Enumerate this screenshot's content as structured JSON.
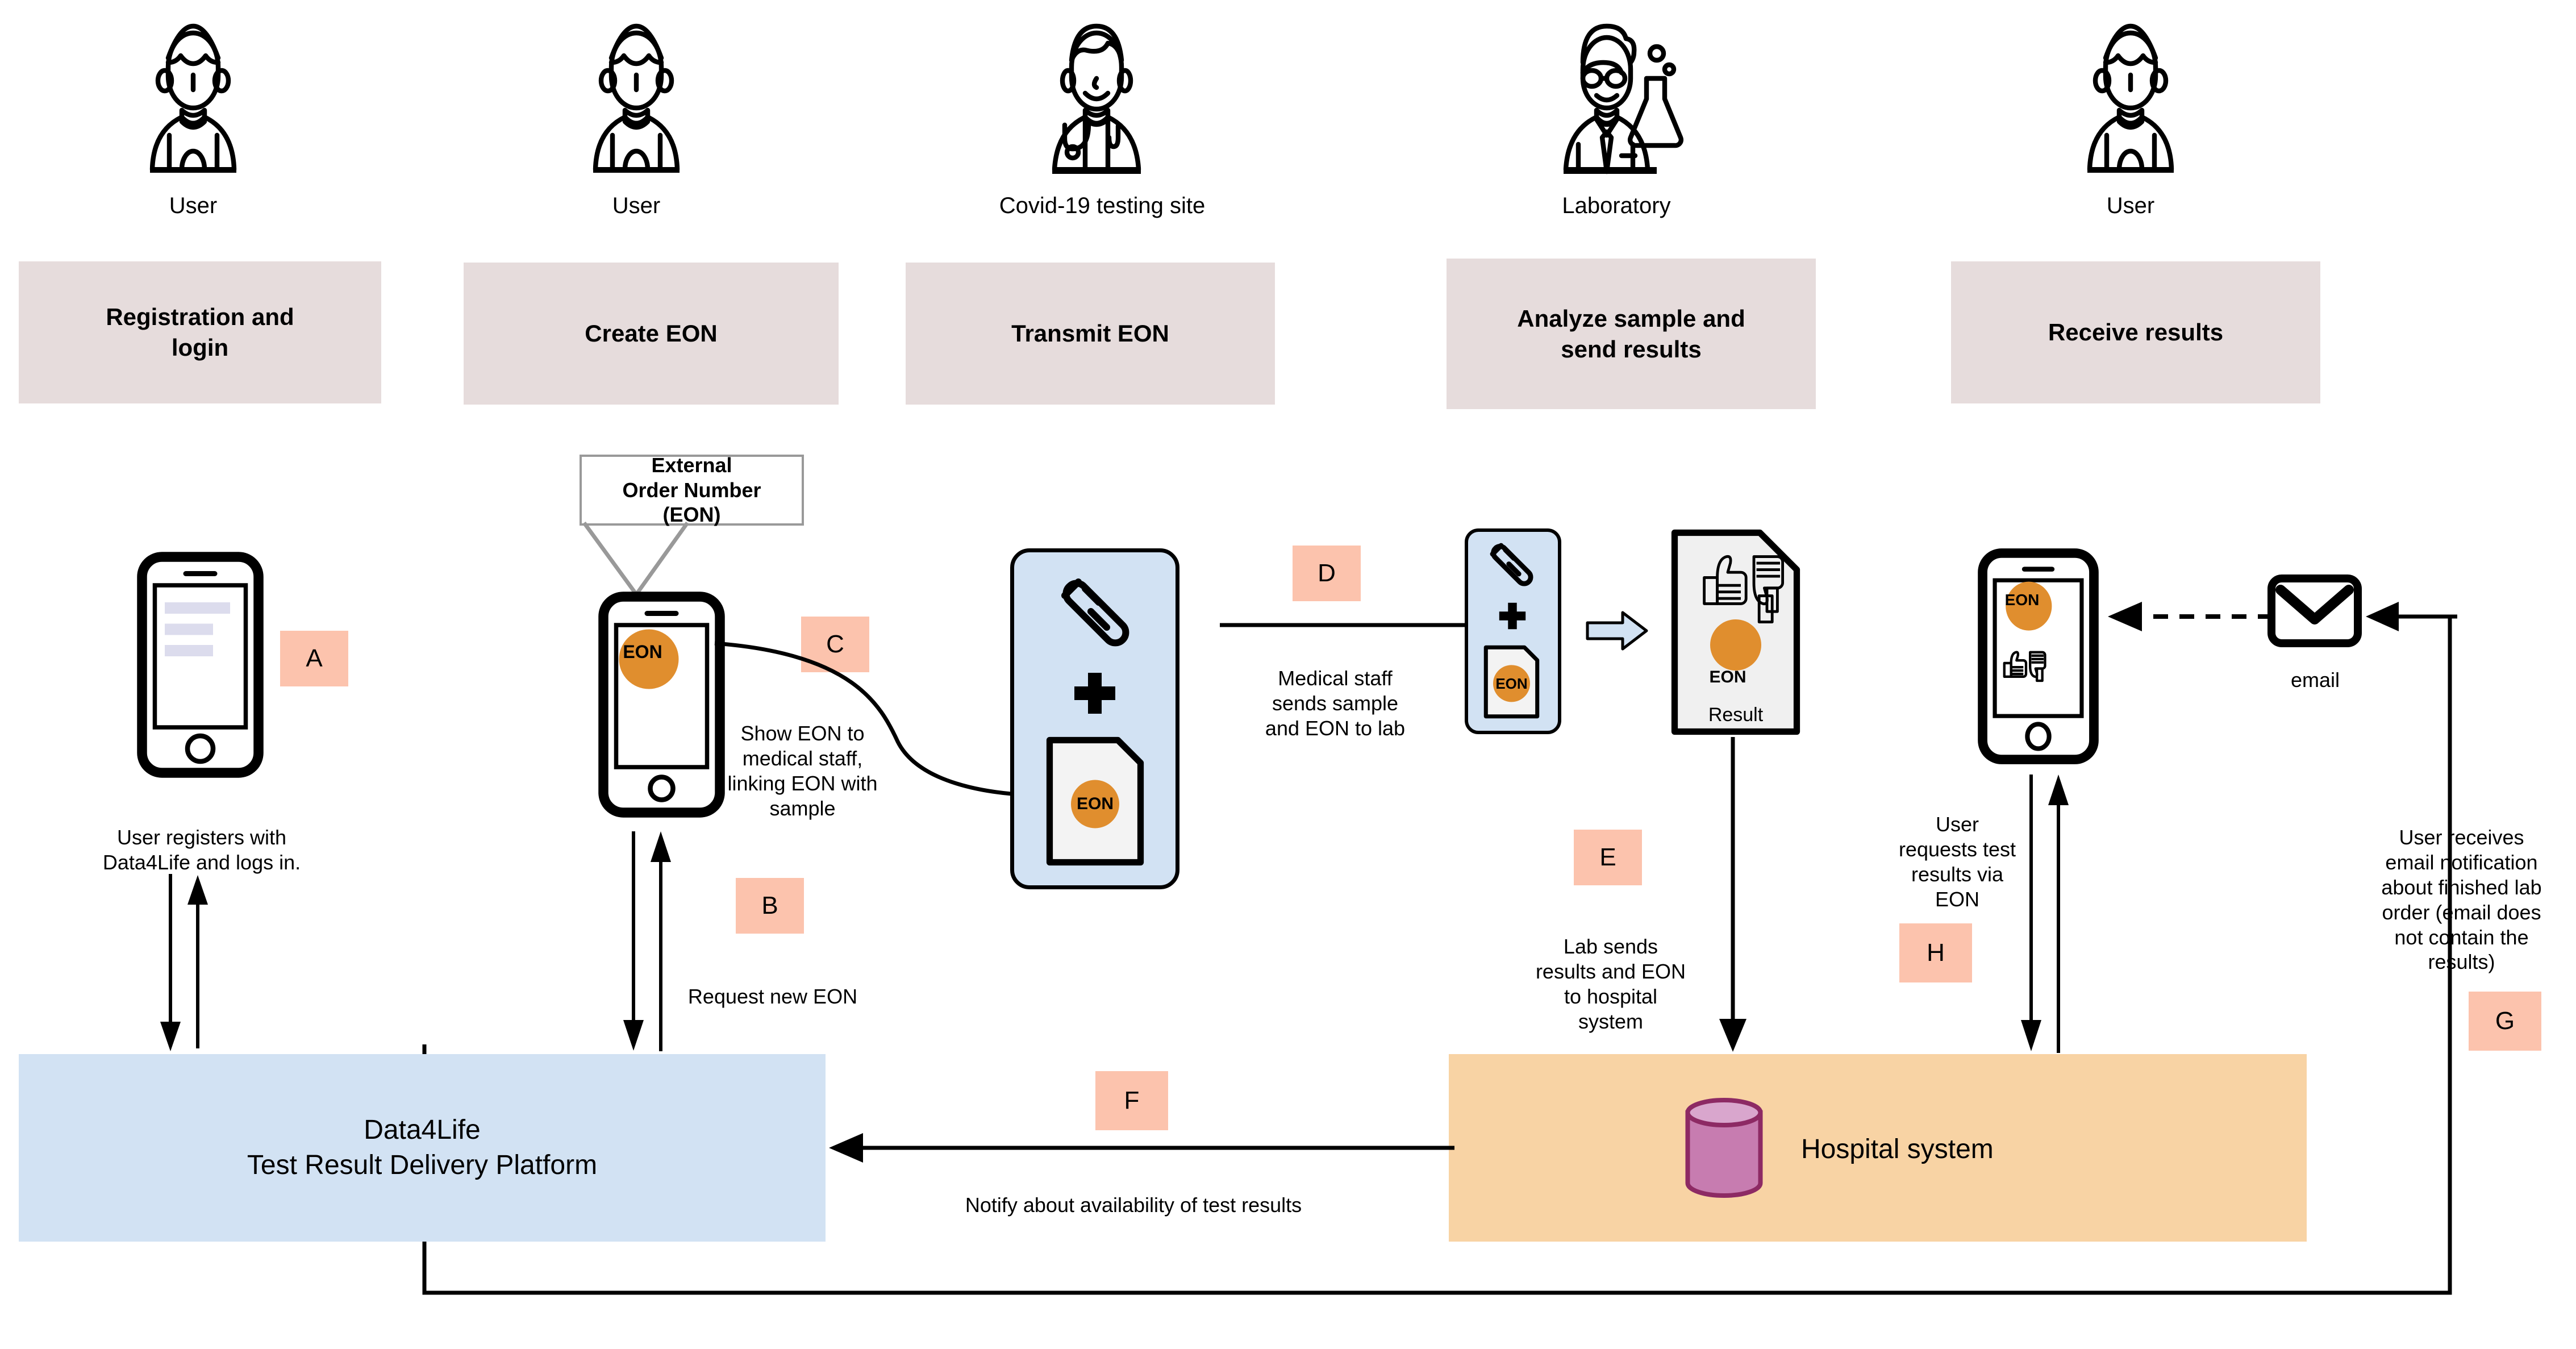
{
  "phases": [
    {
      "label": "Registration and\nlogin",
      "actor": "User"
    },
    {
      "label": "Create EON",
      "actor": "User"
    },
    {
      "label": "Transmit EON",
      "actor": "Covid-19 testing site"
    },
    {
      "label": "Analyze sample and\nsend results",
      "actor": "Laboratory"
    },
    {
      "label": "Receive results",
      "actor": "User"
    }
  ],
  "callout": {
    "line1": "External",
    "line2": "Order Number",
    "line3": "(EON)"
  },
  "badges": {
    "a": "A",
    "b": "B",
    "c": "C",
    "d": "D",
    "e": "E",
    "f": "F",
    "g": "G",
    "h": "H"
  },
  "notes": {
    "a": "User registers with\nData4Life and logs in.",
    "b": "Request new EON",
    "c": "Show EON to\nmedical staff,\nlinking EON with\nsample",
    "d": "Medical staff\nsends sample\nand EON to lab",
    "e": "Lab sends\nresults and EON\nto hospital\nsystem",
    "f": "Notify about availability of test results",
    "g": "User receives\nemail notification\nabout finished lab\norder (email does\nnot contain the\nresults)",
    "h": "User\nrequests test\nresults via\nEON"
  },
  "labels": {
    "eon": "EON",
    "result": "Result",
    "email": "email",
    "platform_line1": "Data4Life",
    "platform_line2": "Test Result Delivery Platform",
    "hospital": "Hospital system"
  },
  "colors": {
    "phase_box": "#e6dcdc",
    "badge": "#fcc3ad",
    "platform": "#d2e2f3",
    "hospital": "#f8d3a4",
    "eon_orange": "#e08e2e",
    "db_cylinder": "#c77cb0",
    "db_cylinder_dark": "#8d2a64",
    "callout_border": "#999999",
    "result_doc": "#f0f0f0",
    "line": "#000000"
  }
}
